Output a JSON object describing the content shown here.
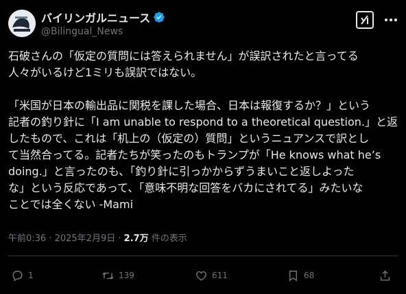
{
  "author": {
    "display_name": "バイリンガルニュース",
    "handle": "@Bilingual_News",
    "verified": true
  },
  "tweet": {
    "lines": [
      "石破さんの「仮定の質問には答えられません」が誤訳されたと言ってる",
      "人々がいるけど1ミリも誤訳ではない。",
      "",
      "「米国が日本の輸出品に関税を課した場合、日本は報復するか？」という",
      "記者の釣り針に「I am unable to respond to a theoretical question.」と返",
      "したもので、これは「机上の（仮定の）質問」というニュアンスで訳とし",
      "て当然合ってる。記者たちが笑ったのもトランプが「He knows what he’s",
      "doing.」と言ったのも、「釣り針に引っかからずうまいこと返しよった",
      "な」という反応であって、「意味不明な回答をバカにされてる」みたいな",
      "ことでは全くない -Mami"
    ]
  },
  "meta": {
    "time": "午前0:36",
    "sep1": " · ",
    "date": "2025年2月9日",
    "sep2": " · ",
    "views_count": "2.7万",
    "views_label": " 件の表示"
  },
  "actions": {
    "replies": "1",
    "reposts": "139",
    "likes": "611",
    "bookmarks": "68"
  },
  "colors": {
    "background": "#000000",
    "text": "#e7e9ea",
    "muted": "#71767b",
    "verified": "#1d9bf0"
  },
  "icons": [
    "avatar-logo",
    "verified-badge-icon",
    "grok-icon",
    "more-icon",
    "reply-icon",
    "repost-icon",
    "like-icon",
    "bookmark-icon",
    "share-icon"
  ]
}
